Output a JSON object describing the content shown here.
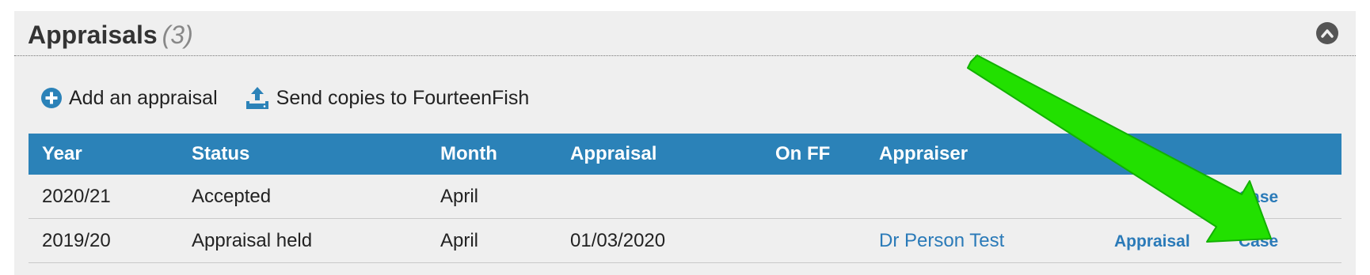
{
  "panel": {
    "title": "Appraisals",
    "count": "(3)"
  },
  "actions": {
    "add_label": "Add an appraisal",
    "send_label": "Send copies to FourteenFish"
  },
  "table": {
    "columns": [
      "Year",
      "Status",
      "Month",
      "Appraisal",
      "On FF",
      "Appraiser",
      "",
      ""
    ],
    "rows": [
      {
        "year": "2020/21",
        "status": "Accepted",
        "month": "April",
        "appraisal": "",
        "on_ff": "",
        "appraiser": "",
        "appraisal_link": "",
        "case_link": "Case"
      },
      {
        "year": "2019/20",
        "status": "Appraisal held",
        "month": "April",
        "appraisal": "01/03/2020",
        "on_ff": "",
        "appraiser": "Dr Person Test",
        "appraisal_link": "Appraisal",
        "case_link": "Case"
      }
    ]
  },
  "colors": {
    "header_bg": "#2b82b8",
    "link": "#2a7ab8",
    "annotation_arrow": "#22e000"
  },
  "icons": {
    "add": "plus-circle-icon",
    "send": "upload-tray-icon",
    "collapse": "chevron-up-circle-icon"
  }
}
